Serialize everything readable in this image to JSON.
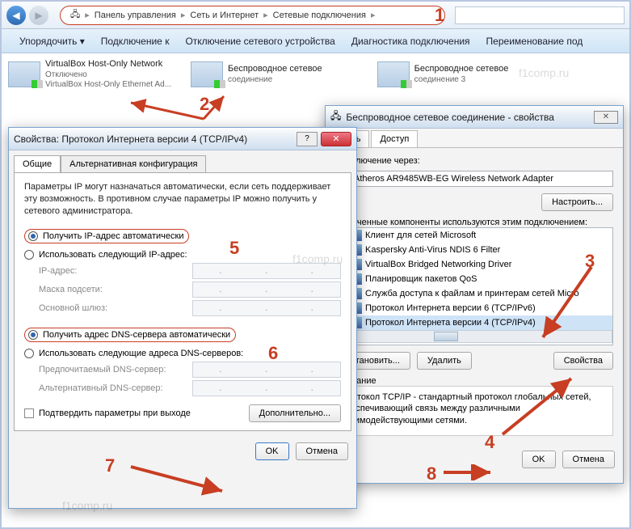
{
  "nav": {
    "crumbs": [
      "Панель управления",
      "Сеть и Интернет",
      "Сетевые подключения"
    ]
  },
  "toolbar": [
    "Упорядочить ▾",
    "Подключение к",
    "Отключение сетевого устройства",
    "Диагностика подключения",
    "Переименование под"
  ],
  "connections": {
    "0": {
      "title": "VirtualBox Host-Only Network",
      "status": "Отключено",
      "adapter": "VirtualBox Host-Only Ethernet Ad..."
    },
    "1": {
      "title": "Беспроводное сетевое",
      "sub": "соединение"
    },
    "2": {
      "title": "Беспроводное сетевое",
      "sub": "соединение 3"
    }
  },
  "propsDialog": {
    "title": "Беспроводное сетевое соединение - свойства",
    "tabs": {
      "0": "Сеть",
      "1": "Доступ"
    },
    "connect_label": "Подключение через:",
    "adapter": "Atheros AR9485WB-EG Wireless Network Adapter",
    "configure": "Настроить...",
    "components_label": "Отмеченные компоненты используются этим подключением:",
    "items": {
      "0": "Клиент для сетей Microsoft",
      "1": "Kaspersky Anti-Virus NDIS 6 Filter",
      "2": "VirtualBox Bridged Networking Driver",
      "3": "Планировщик пакетов QoS",
      "4": "Служба доступа к файлам и принтерам сетей Micro",
      "5": "Протокол Интернета версии 6 (TCP/IPv6)",
      "6": "Протокол Интернета версии 4 (TCP/IPv4)"
    },
    "install": "Установить...",
    "remove": "Удалить",
    "properties": "Свойства",
    "desc_label": "Описание",
    "desc": "Протокол TCP/IP - стандартный протокол глобальных сетей, обеспечивающий связь между различными взаимодействующими сетями.",
    "ok": "OK",
    "cancel": "Отмена"
  },
  "ipDialog": {
    "title": "Свойства: Протокол Интернета версии 4 (TCP/IPv4)",
    "tabs": {
      "0": "Общие",
      "1": "Альтернативная конфигурация"
    },
    "desc": "Параметры IP могут назначаться автоматически, если сеть поддерживает эту возможность. В противном случае параметры IP можно получить у сетевого администратора.",
    "r_auto_ip": "Получить IP-адрес автоматически",
    "r_man_ip": "Использовать следующий IP-адрес:",
    "ip_label": "IP-адрес:",
    "mask_label": "Маска подсети:",
    "gw_label": "Основной шлюз:",
    "r_auto_dns": "Получить адрес DNS-сервера автоматически",
    "r_man_dns": "Использовать следующие адреса DNS-серверов:",
    "dns1_label": "Предпочитаемый DNS-сервер:",
    "dns2_label": "Альтернативный DNS-сервер:",
    "confirm": "Подтвердить параметры при выходе",
    "advanced": "Дополнительно...",
    "ok": "OK",
    "cancel": "Отмена"
  },
  "annotations": {
    "1": "1",
    "2": "2",
    "3": "3",
    "4": "4",
    "5": "5",
    "6": "6",
    "7": "7",
    "8": "8"
  },
  "watermark": "f1comp.ru"
}
